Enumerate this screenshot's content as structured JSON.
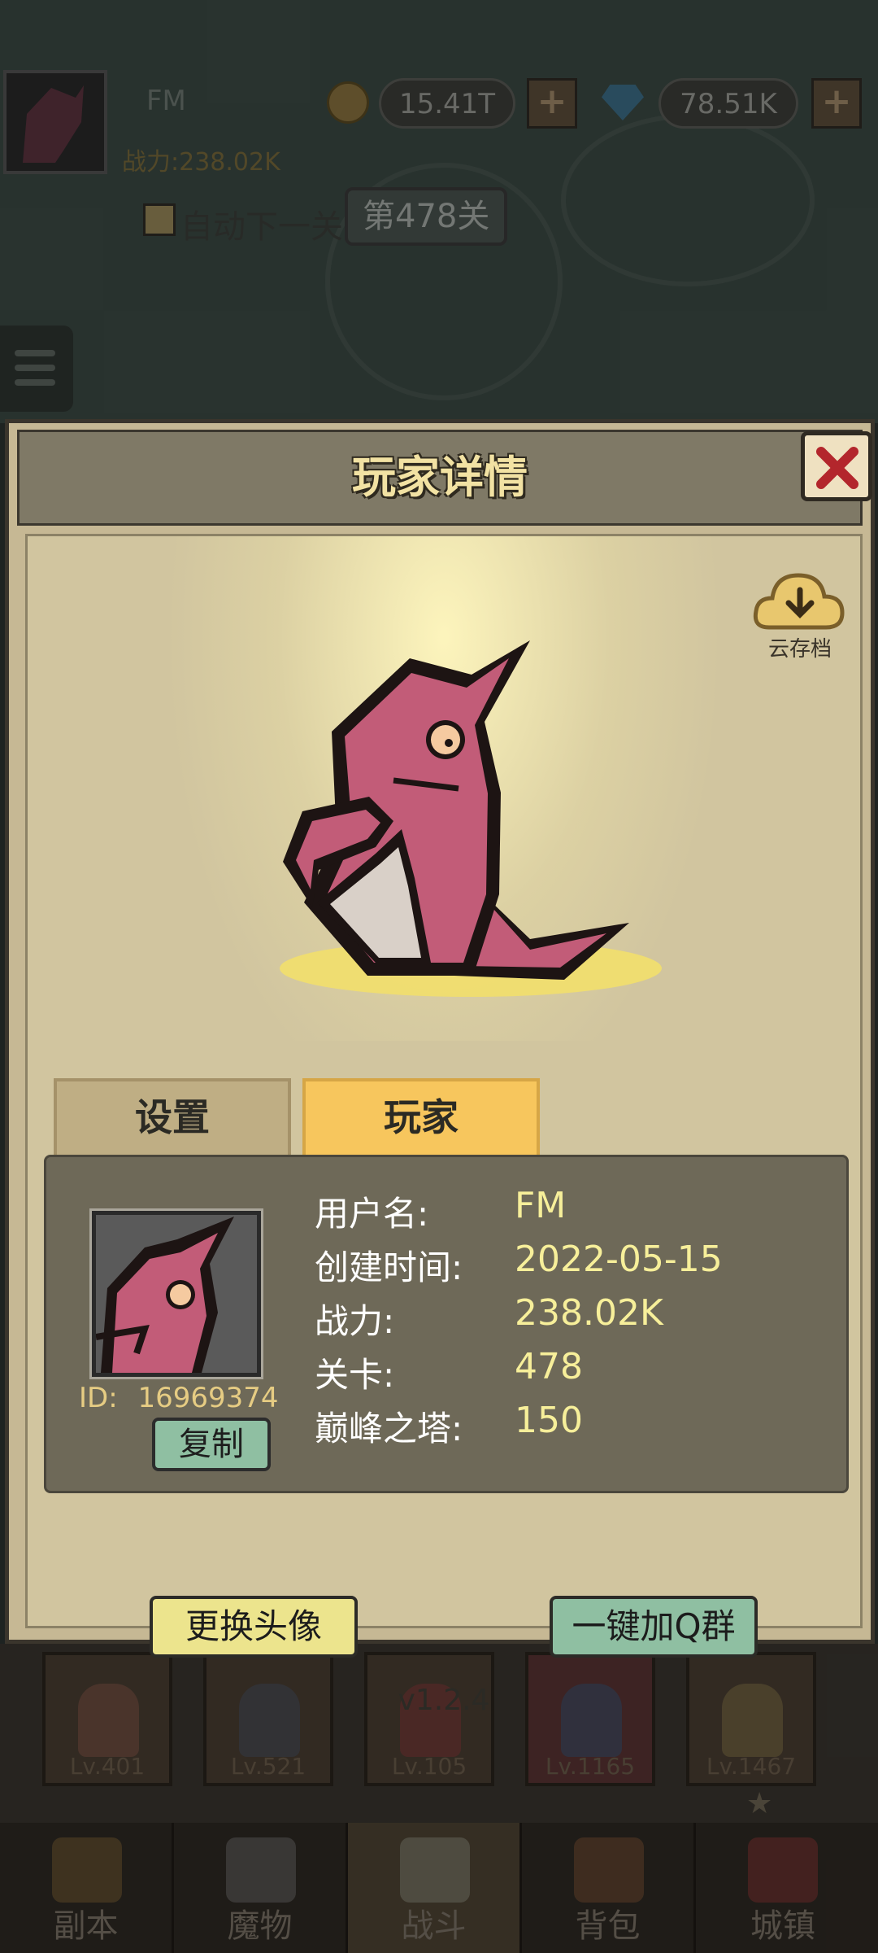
{
  "topbar": {
    "player_name": "FM",
    "gold": "15.41T",
    "gems": "78.51K",
    "power_label": "战力:238.02K",
    "auto_next_label": "自动下一关",
    "stage_label": "第478关"
  },
  "modal": {
    "title": "玩家详情",
    "cloud_save_label": "云存档",
    "tabs": [
      {
        "label": "设置",
        "active": false
      },
      {
        "label": "玩家",
        "active": true
      }
    ],
    "player": {
      "id_label": "ID:",
      "id_value": "16969374",
      "copy_label": "复制",
      "rows": [
        {
          "label": "用户名:",
          "value": "FM"
        },
        {
          "label": "创建时间:",
          "value": "2022-05-15"
        },
        {
          "label": "战力:",
          "value": "238.02K"
        },
        {
          "label": "关卡:",
          "value": "478"
        },
        {
          "label": "巅峰之塔:",
          "value": "150"
        }
      ]
    },
    "buttons": {
      "change_avatar": "更换头像",
      "join_qq": "一键加Q群"
    },
    "version": "v1.2.4"
  },
  "heroes": [
    {
      "level": "Lv.401"
    },
    {
      "level": "Lv.521"
    },
    {
      "level": "Lv.105"
    },
    {
      "level": "Lv.1165"
    },
    {
      "level": "Lv.1467"
    }
  ],
  "nav": [
    {
      "label": "副本",
      "icon": "map-icon",
      "active": false
    },
    {
      "label": "魔物",
      "icon": "monster-icon",
      "active": false
    },
    {
      "label": "战斗",
      "icon": "crossed-swords-icon",
      "active": true
    },
    {
      "label": "背包",
      "icon": "backpack-icon",
      "active": false
    },
    {
      "label": "城镇",
      "icon": "shop-icon",
      "active": false
    }
  ],
  "colors": {
    "modal_bg": "#c6b894",
    "title_text": "#f2e2a3",
    "active_tab": "#f7c65d",
    "value_text": "#f7ef9a",
    "copy_button": "#8fbfa2",
    "avatar_button": "#ece48d",
    "close_x": "#b3262c",
    "dragon": "#c25c78"
  }
}
